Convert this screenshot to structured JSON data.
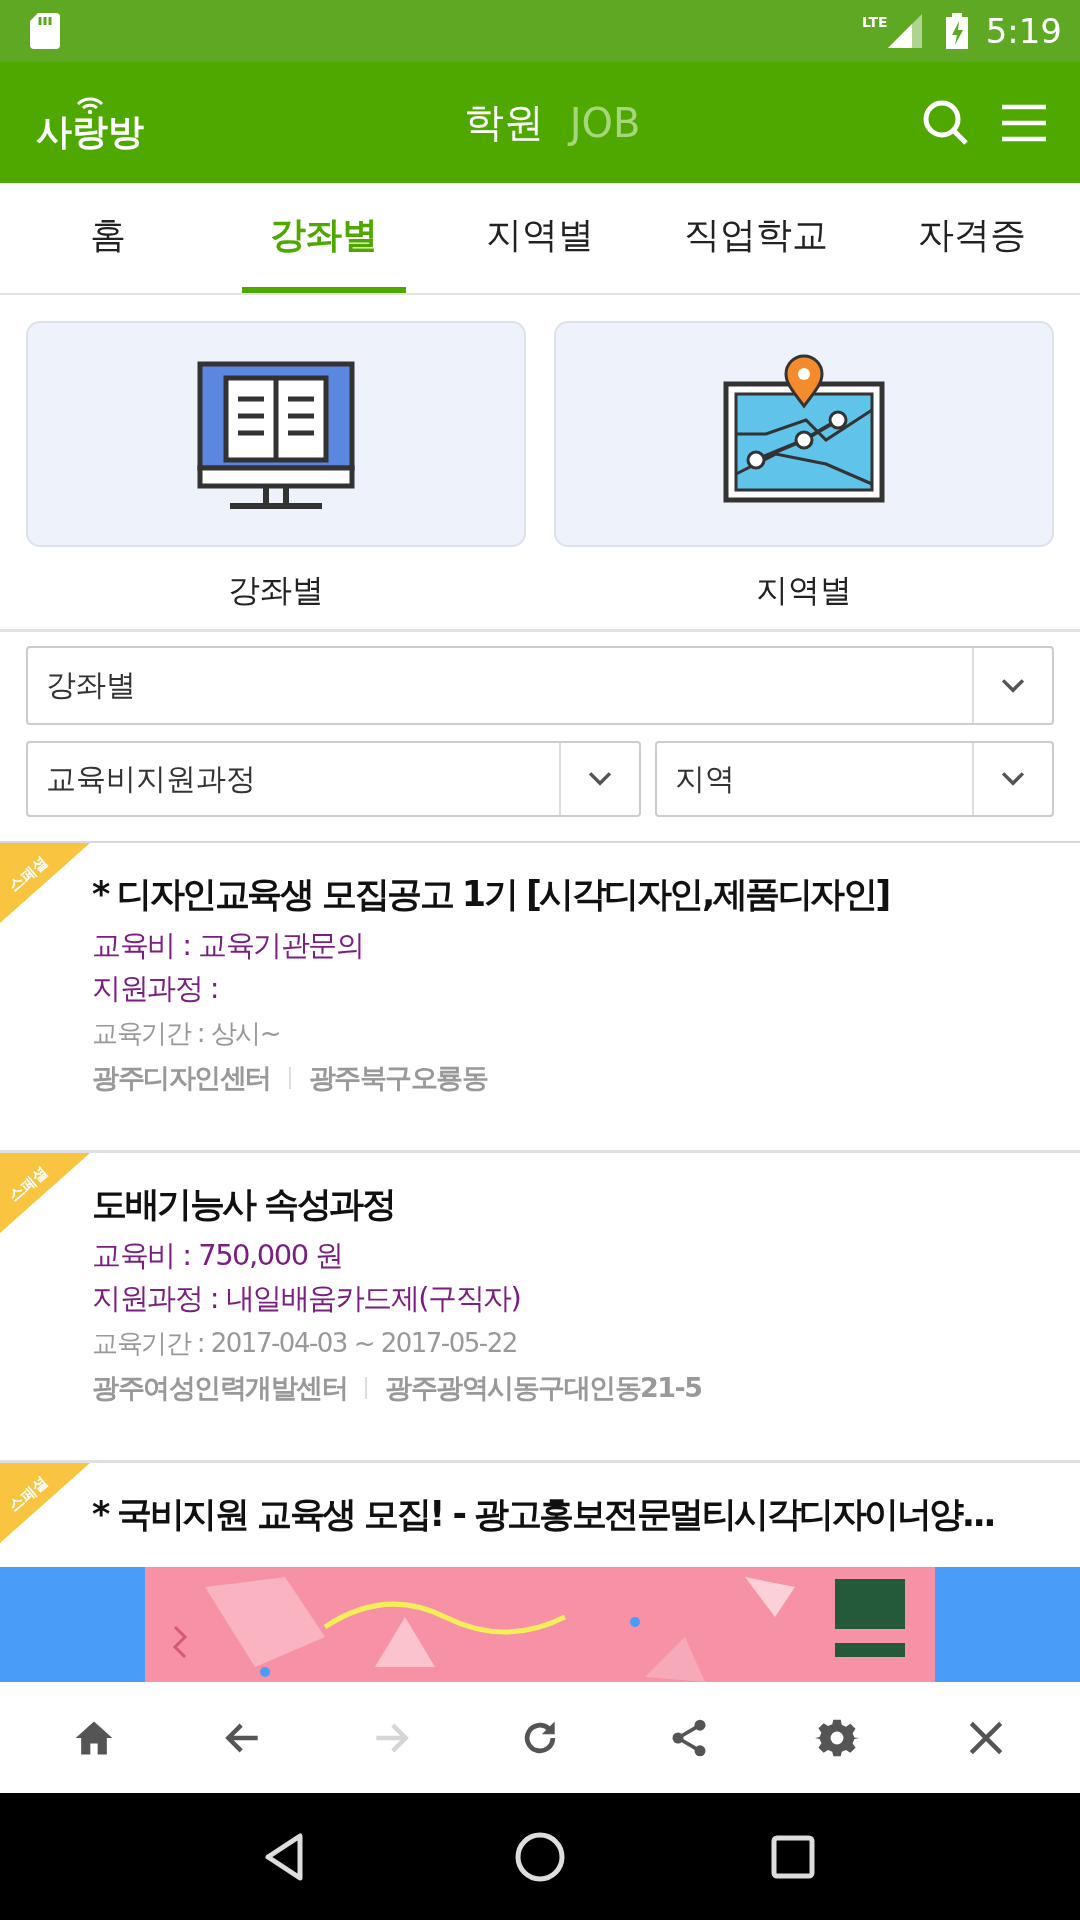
{
  "status_bar": {
    "time": "5:19",
    "network": "LTE"
  },
  "app_bar": {
    "logo": "사랑방",
    "sections": [
      {
        "label": "학원",
        "selected": true
      },
      {
        "label": "JOB",
        "selected": false
      }
    ]
  },
  "tabs": [
    {
      "label": "홈",
      "selected": false
    },
    {
      "label": "강좌별",
      "selected": true
    },
    {
      "label": "지역별",
      "selected": false
    },
    {
      "label": "직업학교",
      "selected": false
    },
    {
      "label": "자격증",
      "selected": false
    }
  ],
  "categories": [
    {
      "kind": "monitor",
      "label": "강좌별"
    },
    {
      "kind": "map",
      "label": "지역별"
    }
  ],
  "filters": {
    "category": "강좌별",
    "course_type": "교육비지원과정",
    "region": "지역"
  },
  "listings": [
    {
      "badge": "스페셜",
      "title": "* 디자인교육생 모집공고 1기 [시각디자인,제품디자인]",
      "fee": "교육비 : 교육기관문의",
      "course": "지원과정 :",
      "period": "교육기간 : 상시~",
      "organization": "광주디자인센터",
      "address": "광주북구오룡동"
    },
    {
      "badge": "스페셜",
      "title": "도배기능사 속성과정",
      "fee": "교육비 : 750,000 원",
      "course": "지원과정 : 내일배움카드제(구직자)",
      "period": "교육기간 : 2017-04-03 ~ 2017-05-22",
      "organization": "광주여성인력개발센터",
      "address": "광주광역시동구대인동21-5"
    },
    {
      "badge": "스페셜",
      "title": "* 국비지원 교육생 모집! - 광고홍보전문멀티시각디자이너양..."
    }
  ],
  "toolbar": [
    {
      "kind": "home",
      "disabled": false
    },
    {
      "kind": "back",
      "disabled": false
    },
    {
      "kind": "forward",
      "disabled": true
    },
    {
      "kind": "refresh",
      "disabled": false
    },
    {
      "kind": "share",
      "disabled": false
    },
    {
      "kind": "settings",
      "disabled": false
    },
    {
      "kind": "close",
      "disabled": false
    }
  ]
}
